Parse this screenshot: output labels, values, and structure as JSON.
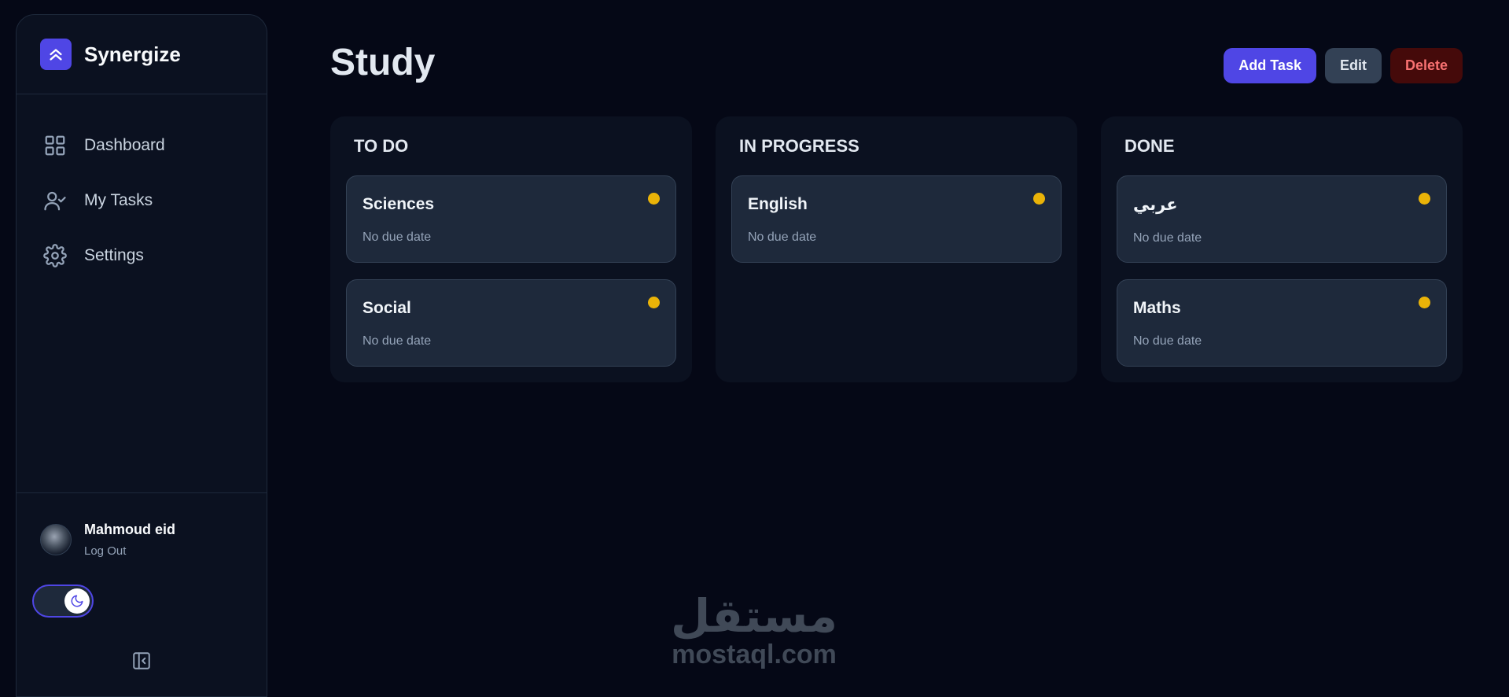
{
  "app": {
    "name": "Synergize",
    "logo_icon": "chevrons-up-icon",
    "accent": "#4f46e5"
  },
  "sidebar": {
    "items": [
      {
        "label": "Dashboard",
        "icon": "grid-icon"
      },
      {
        "label": "My Tasks",
        "icon": "user-check-icon"
      },
      {
        "label": "Settings",
        "icon": "gear-icon"
      }
    ],
    "user": {
      "name": "Mahmoud eid",
      "logout": "Log Out"
    },
    "theme_toggle": {
      "mode": "dark",
      "icon": "moon-icon"
    },
    "collapse_icon": "sidebar-collapse-icon"
  },
  "page": {
    "title": "Study",
    "actions": {
      "add": "Add Task",
      "edit": "Edit",
      "delete": "Delete"
    }
  },
  "columns": [
    {
      "title": "TO DO",
      "cards": [
        {
          "title": "Sciences",
          "due": "No due date"
        },
        {
          "title": "Social",
          "due": "No due date"
        }
      ]
    },
    {
      "title": "IN PROGRESS",
      "cards": [
        {
          "title": "English",
          "due": "No due date"
        }
      ]
    },
    {
      "title": "DONE",
      "cards": [
        {
          "title": "عربي",
          "due": "No due date"
        },
        {
          "title": "Maths",
          "due": "No due date"
        }
      ]
    }
  ],
  "status_color": "#eab308",
  "watermark": {
    "arabic": "مستقل",
    "latin": "mostaql.com"
  }
}
